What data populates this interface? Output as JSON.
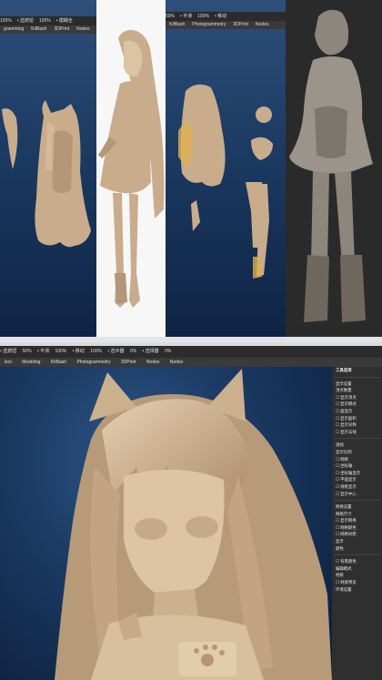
{
  "top": {
    "panel1": {
      "toolbar": [
        "100%",
        "• 选按钮",
        "100%",
        "• 模糊全"
      ],
      "menu": [
        "gramming",
        "KitBash",
        "3DPrint",
        "Nodes"
      ]
    },
    "panel3": {
      "toolbar": [
        "50%",
        "• 平滑",
        "100%",
        "• 移动"
      ],
      "menu": [
        "KitBash",
        "Photogrammetry",
        "3DPrint",
        "Nodes"
      ]
    }
  },
  "bottom": {
    "toolbar": [
      "• 选按钮",
      "50%",
      "• 平滑",
      "100%",
      "• 移动",
      "100%",
      "• 选中器",
      "0%",
      "• 选择器",
      "0%"
    ],
    "menu": [
      "lect",
      "Modeling",
      "KitBash",
      "Photogrammetry",
      "3DPrint",
      "Nodes",
      "Nodes"
    ],
    "panel": {
      "title": "工具选项",
      "rows": [
        "显示设置",
        "顶点数量",
        "☐ 显示顶点",
        "☐ 显示模式",
        "☐ 面显示",
        "☐ 显示面积",
        "☐ 显示对称",
        "☐ 显示法线",
        "透视",
        "显示比例",
        "☐ 网格",
        "☐ 坐标轴",
        "☐ 坐标轴显示",
        "☐ 平面显示",
        "☐ 线框显示",
        "☐ 显示中心",
        "网格设置",
        "网格尺寸",
        "☐ 显示网格",
        "☐ 网格颜色",
        "☐ 网格间距",
        "显示",
        "颜色",
        "☐ 背景颜色",
        "编辑模式",
        "材质",
        "☐ 材质预览",
        "环境设置"
      ]
    }
  }
}
